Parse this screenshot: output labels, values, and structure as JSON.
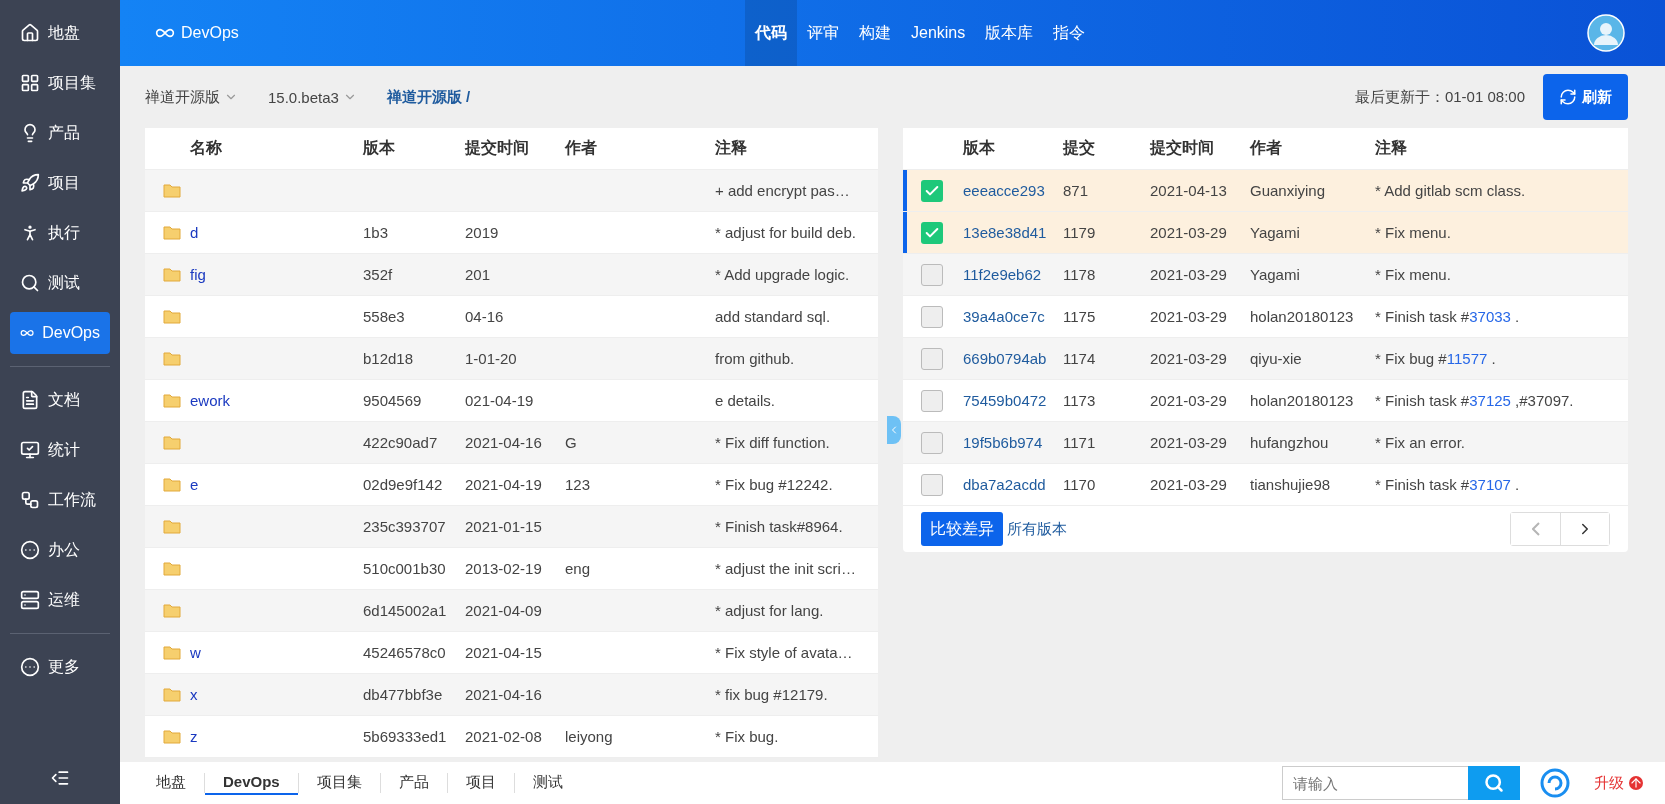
{
  "sidebar": {
    "items": [
      {
        "kind": "item",
        "label": "地盘",
        "selected": false
      },
      {
        "kind": "item",
        "label": "项目集",
        "selected": false
      },
      {
        "kind": "item",
        "label": "产品",
        "selected": false
      },
      {
        "kind": "item",
        "label": "项目",
        "selected": false
      },
      {
        "kind": "item",
        "label": "执行",
        "selected": false
      },
      {
        "kind": "item",
        "label": "测试",
        "selected": false
      },
      {
        "kind": "item",
        "label": "DevOps",
        "selected": true
      },
      {
        "kind": "divider"
      },
      {
        "kind": "item",
        "label": "文档",
        "selected": false
      },
      {
        "kind": "item",
        "label": "统计",
        "selected": false
      },
      {
        "kind": "item",
        "label": "工作流",
        "selected": false
      },
      {
        "kind": "item",
        "label": "办公",
        "selected": false
      },
      {
        "kind": "item",
        "label": "运维",
        "selected": false
      },
      {
        "kind": "divider"
      },
      {
        "kind": "item",
        "label": "更多",
        "selected": false
      }
    ]
  },
  "topbar": {
    "app": "DevOps",
    "tabs": [
      {
        "label": "代码",
        "selected": true
      },
      {
        "label": "评审",
        "selected": false
      },
      {
        "label": "构建",
        "selected": false
      },
      {
        "label": "Jenkins",
        "selected": false
      },
      {
        "label": "版本库",
        "selected": false
      },
      {
        "label": "指令",
        "selected": false
      }
    ]
  },
  "breadcrumb": {
    "repo": "禅道开源版",
    "branch": "15.0.beta3",
    "path": "禅道开源版 /",
    "updated_label": "最后更新于：01-01 08:00",
    "refresh": "刷新"
  },
  "files": {
    "columns": [
      "名称",
      "版本",
      "提交时间",
      "作者",
      "注释"
    ],
    "rows": [
      {
        "name": "",
        "version": "",
        "time": "",
        "author": "",
        "note": "+ add encrypt pas…"
      },
      {
        "name": "d",
        "version": "1b3",
        "time": "2019",
        "author": "",
        "note": "* adjust for build deb."
      },
      {
        "name": "fig",
        "version": "352f",
        "time": "201",
        "author": "",
        "note": "* Add upgrade logic."
      },
      {
        "name": "",
        "version": "558e3",
        "time": "04-16",
        "author": "",
        "note": "add standard sql."
      },
      {
        "name": "",
        "version": "b12d18",
        "time": "1-01-20",
        "author": "",
        "note": "from github."
      },
      {
        "name": "ework",
        "version": "9504569",
        "time": "021-04-19",
        "author": "",
        "note": "e details."
      },
      {
        "name": "",
        "version": "422c90ad7",
        "time": "2021-04-16",
        "author": "G",
        "note": "* Fix diff function."
      },
      {
        "name": "e",
        "version": "02d9e9f142",
        "time": "2021-04-19",
        "author": "123",
        "note": "* Fix bug #12242."
      },
      {
        "name": "",
        "version": "235c393707",
        "time": "2021-01-15",
        "author": "",
        "note": "* Finish task#8964."
      },
      {
        "name": "",
        "version": "510c001b30",
        "time": "2013-02-19",
        "author": "eng",
        "note": "* adjust the init scri…"
      },
      {
        "name": "",
        "version": "6d145002a1",
        "time": "2021-04-09",
        "author": "",
        "note": "* adjust for lang."
      },
      {
        "name": "w",
        "version": "45246578c0",
        "time": "2021-04-15",
        "author": "",
        "note": "* Fix style of avata…"
      },
      {
        "name": "x",
        "version": "db477bbf3e",
        "time": "2021-04-16",
        "author": "",
        "note": "* fix bug #12179."
      },
      {
        "name": "z",
        "version": "5b69333ed1",
        "time": "2021-02-08",
        "author": "leiyong",
        "note": "* Fix bug."
      }
    ]
  },
  "commits": {
    "columns": [
      "版本",
      "提交",
      "提交时间",
      "作者",
      "注释"
    ],
    "rows": [
      {
        "checked": true,
        "version": "eeeacce293",
        "commit": "871",
        "time": "2021-04-13",
        "author": "Guanxiying",
        "note": [
          {
            "kind": "text",
            "text": "* Add gitlab scm class."
          }
        ]
      },
      {
        "checked": true,
        "version": "13e8e38d41",
        "commit": "1179",
        "time": "2021-03-29",
        "author": "Yagami",
        "note": [
          {
            "kind": "text",
            "text": "* Fix menu."
          }
        ]
      },
      {
        "checked": false,
        "version": "11f2e9eb62",
        "commit": "1178",
        "time": "2021-03-29",
        "author": "Yagami",
        "note": [
          {
            "kind": "text",
            "text": "* Fix menu."
          }
        ]
      },
      {
        "checked": false,
        "version": "39a4a0ce7c",
        "commit": "1175",
        "time": "2021-03-29",
        "author": "holan20180123",
        "note": [
          {
            "kind": "text",
            "text": "* Finish task #"
          },
          {
            "kind": "link",
            "text": "37033"
          },
          {
            "kind": "text",
            "text": " ."
          }
        ]
      },
      {
        "checked": false,
        "version": "669b0794ab",
        "commit": "1174",
        "time": "2021-03-29",
        "author": "qiyu-xie",
        "note": [
          {
            "kind": "text",
            "text": "* Fix bug #"
          },
          {
            "kind": "link",
            "text": "11577"
          },
          {
            "kind": "text",
            "text": " ."
          }
        ]
      },
      {
        "checked": false,
        "version": "75459b0472",
        "commit": "1173",
        "time": "2021-03-29",
        "author": "holan20180123",
        "note": [
          {
            "kind": "text",
            "text": "* Finish task #"
          },
          {
            "kind": "link",
            "text": "37125"
          },
          {
            "kind": "text",
            "text": " ,#37097."
          }
        ]
      },
      {
        "checked": false,
        "version": "19f5b6b974",
        "commit": "1171",
        "time": "2021-03-29",
        "author": "hufangzhou",
        "note": [
          {
            "kind": "text",
            "text": "* Fix an error."
          }
        ]
      },
      {
        "checked": false,
        "version": "dba7a2acdd",
        "commit": "1170",
        "time": "2021-03-29",
        "author": "tianshujie98",
        "note": [
          {
            "kind": "text",
            "text": "* Finish task #"
          },
          {
            "kind": "link",
            "text": "37107"
          },
          {
            "kind": "text",
            "text": " ."
          }
        ]
      }
    ],
    "compare": "比较差异",
    "all_versions": "所有版本",
    "prev_disabled": true,
    "next_disabled": false
  },
  "bottombar": {
    "tabs": [
      {
        "label": "地盘",
        "selected": false
      },
      {
        "label": "DevOps",
        "selected": true
      },
      {
        "label": "项目集",
        "selected": false
      },
      {
        "label": "产品",
        "selected": false
      },
      {
        "label": "项目",
        "selected": false
      },
      {
        "label": "测试",
        "selected": false
      }
    ],
    "search": {
      "placeholder": "请输入"
    },
    "upgrade": "升级"
  }
}
